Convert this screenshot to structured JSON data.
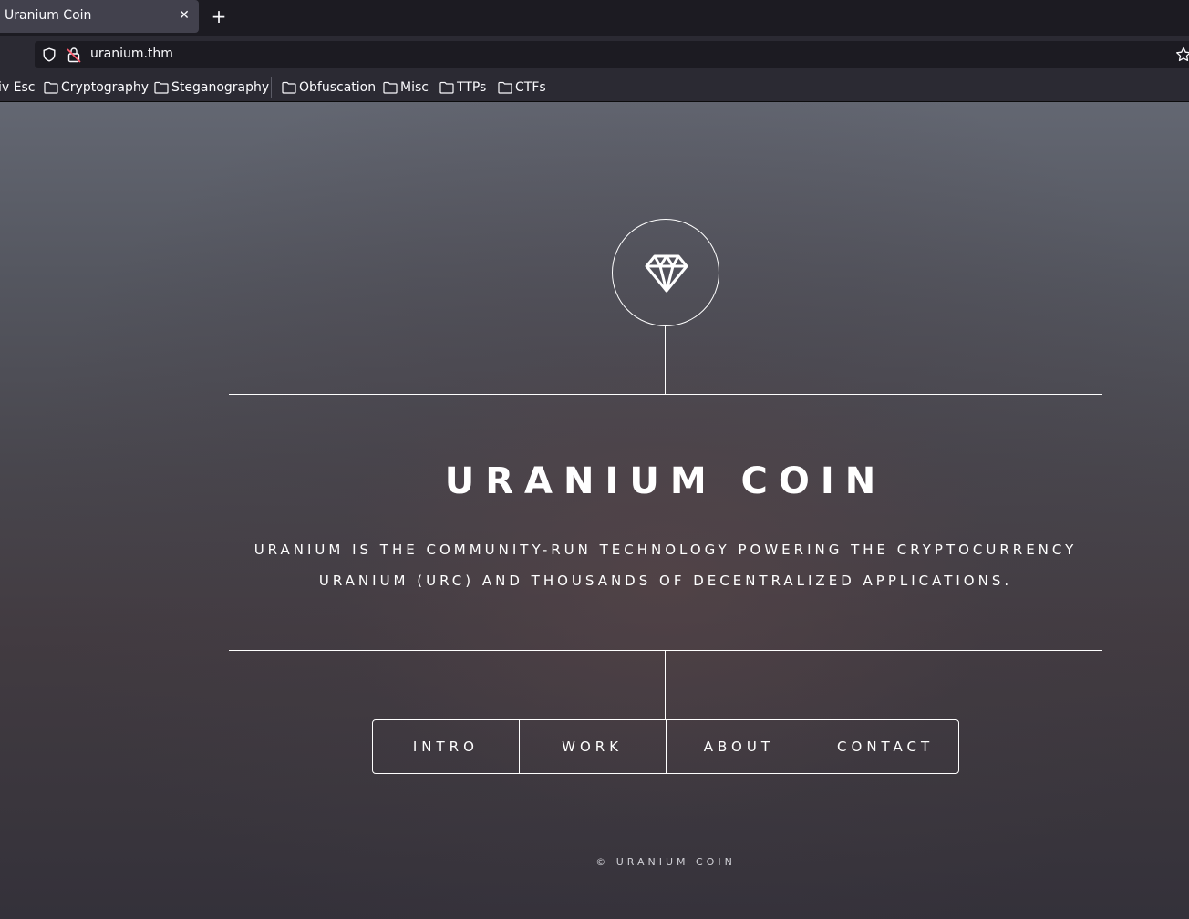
{
  "browser": {
    "tab": {
      "title": "Uranium Coin",
      "close_glyph": "✕"
    },
    "new_tab_glyph": "+",
    "url": "uranium.thm",
    "bookmarks": [
      {
        "label": "iv Esc"
      },
      {
        "label": "Cryptography",
        "icon": "folder-icon"
      },
      {
        "label": "Steganography",
        "icon": "folder-icon"
      },
      {
        "label": "Obfuscation",
        "icon": "folder-icon"
      },
      {
        "label": "Misc",
        "icon": "folder-icon"
      },
      {
        "label": "TTPs",
        "icon": "folder-icon"
      },
      {
        "label": "CTFs",
        "icon": "folder-icon"
      }
    ]
  },
  "page": {
    "logo_icon": "gem-icon",
    "title": "URANIUM COIN",
    "tagline_line1": "URANIUM IS THE COMMUNITY-RUN TECHNOLOGY POWERING THE CRYPTOCURRENCY",
    "tagline_line2": "URANIUM (URC) AND THOUSANDS OF DECENTRALIZED APPLICATIONS.",
    "nav": [
      "INTRO",
      "WORK",
      "ABOUT",
      "CONTACT"
    ],
    "footer": "© URANIUM COIN"
  },
  "colors": {
    "chrome_dark": "#1c1b22",
    "chrome_toolbar": "#2b2a33",
    "tab_active": "#42414d",
    "text": "#ffffff"
  }
}
